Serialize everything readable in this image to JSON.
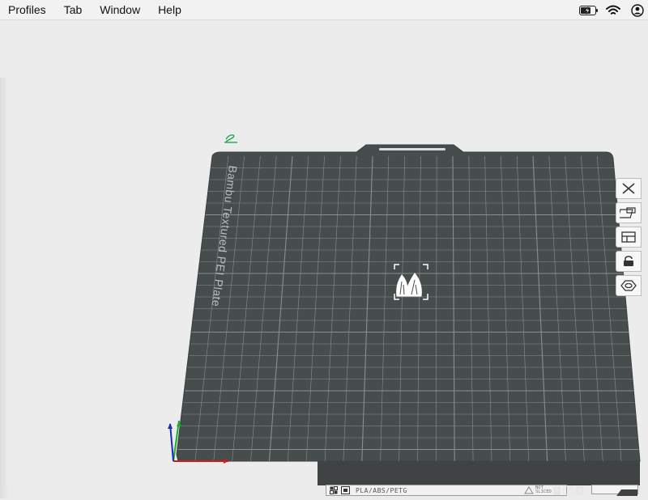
{
  "menubar": {
    "items": [
      {
        "label": "Profiles"
      },
      {
        "label": "Tab"
      },
      {
        "label": "Window"
      },
      {
        "label": "Help"
      }
    ],
    "status_icons": [
      "battery-charging-icon",
      "wifi-icon",
      "user-account-icon"
    ]
  },
  "plate": {
    "name": "Bambu Textured PEI Plate",
    "object_icon": "model-thumbnail-icon",
    "edit_icon": "edit-pencil-icon"
  },
  "right_toolbar": {
    "tools": [
      "close-icon",
      "arrange-icon",
      "layout-icon",
      "lock-icon",
      "plate-settings-icon"
    ]
  },
  "bottom_toolbar": {
    "filament": "PLA/ABS/PETG",
    "status_line1": "NOT",
    "status_line2": "SLICED"
  },
  "colors": {
    "plate": "#474c4c",
    "grid": "#8a8e8e",
    "axis_x": "#d11a1a",
    "axis_y": "#1cab2a",
    "axis_z": "#1a2bb8",
    "edit_icon": "#1fa84a"
  }
}
